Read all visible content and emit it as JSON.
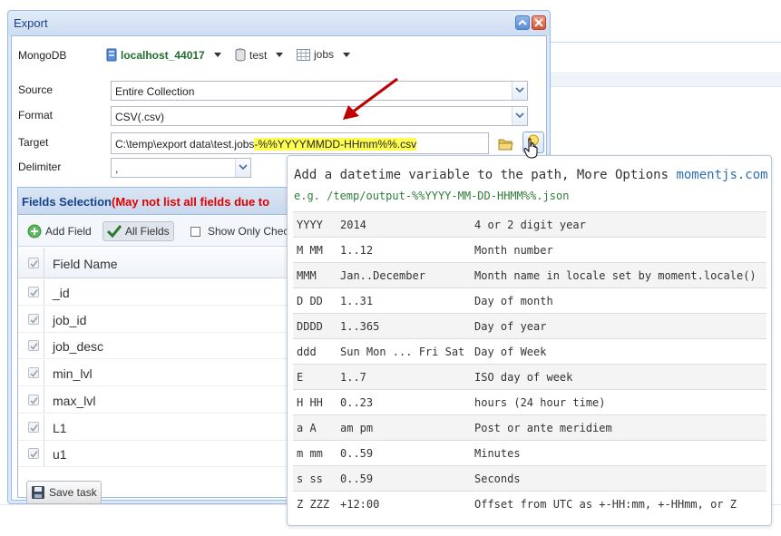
{
  "dialog": {
    "title": "Export",
    "labels": {
      "mongodb": "MongoDB",
      "source": "Source",
      "format": "Format",
      "target": "Target",
      "delimiter": "Delimiter"
    },
    "connection": "localhost_44017",
    "database": "test",
    "collection": "jobs",
    "source_value": "Entire Collection",
    "format_value": "CSV(.csv)",
    "target_value_prefix": "C:\\temp\\export data\\test.jobs",
    "target_value_highlight": "-%%YYYYMMDD-HHmm%%.csv",
    "delimiter_value": ","
  },
  "fields_selection": {
    "title": "Fields Selection",
    "warning": "(May not list all fields due to",
    "toolbar": {
      "add_field": "Add Field",
      "all_fields": "All Fields",
      "show_only_checked": "Show Only Check"
    },
    "column_header": "Field Name",
    "rows": [
      "_id",
      "job_id",
      "job_desc",
      "min_lvl",
      "max_lvl",
      "L1",
      "u1"
    ],
    "save_task": "Save task"
  },
  "tooltip": {
    "title": "Add a datetime variable to the path, More Options ",
    "link": "momentjs.com",
    "example": "e.g. /temp/output-%%YYYY-MM-DD-HHMM%%.json",
    "rows": [
      [
        "YYYY",
        "2014",
        "4 or 2 digit year"
      ],
      [
        "M MM",
        "1..12",
        "Month number"
      ],
      [
        "MMM",
        "Jan..December",
        "Month name in locale set by moment.locale()"
      ],
      [
        "D DD",
        "1..31",
        "Day of month"
      ],
      [
        "DDDD",
        "1..365",
        "Day of year"
      ],
      [
        "ddd",
        "Sun Mon ... Fri Sat",
        "Day of Week"
      ],
      [
        "E",
        "1..7",
        "ISO day of week"
      ],
      [
        "H HH",
        "0..23",
        "hours (24 hour time)"
      ],
      [
        "a A",
        "am pm",
        "Post or ante meridiem"
      ],
      [
        "m mm",
        "0..59",
        "Minutes"
      ],
      [
        "s ss",
        "0..59",
        "Seconds"
      ],
      [
        "Z ZZZ",
        "+12:00",
        "Offset from UTC as +-HH:mm, +-HHmm, or Z"
      ]
    ]
  },
  "colors": {
    "title_blue": "#15428b",
    "warning_red": "#e00000",
    "connection_green": "#1f6f2e",
    "highlight_yellow": "#ffff50",
    "annotation_arrow": "#c00000",
    "link_blue": "#2c6db4",
    "example_green": "#2f7d3a"
  }
}
